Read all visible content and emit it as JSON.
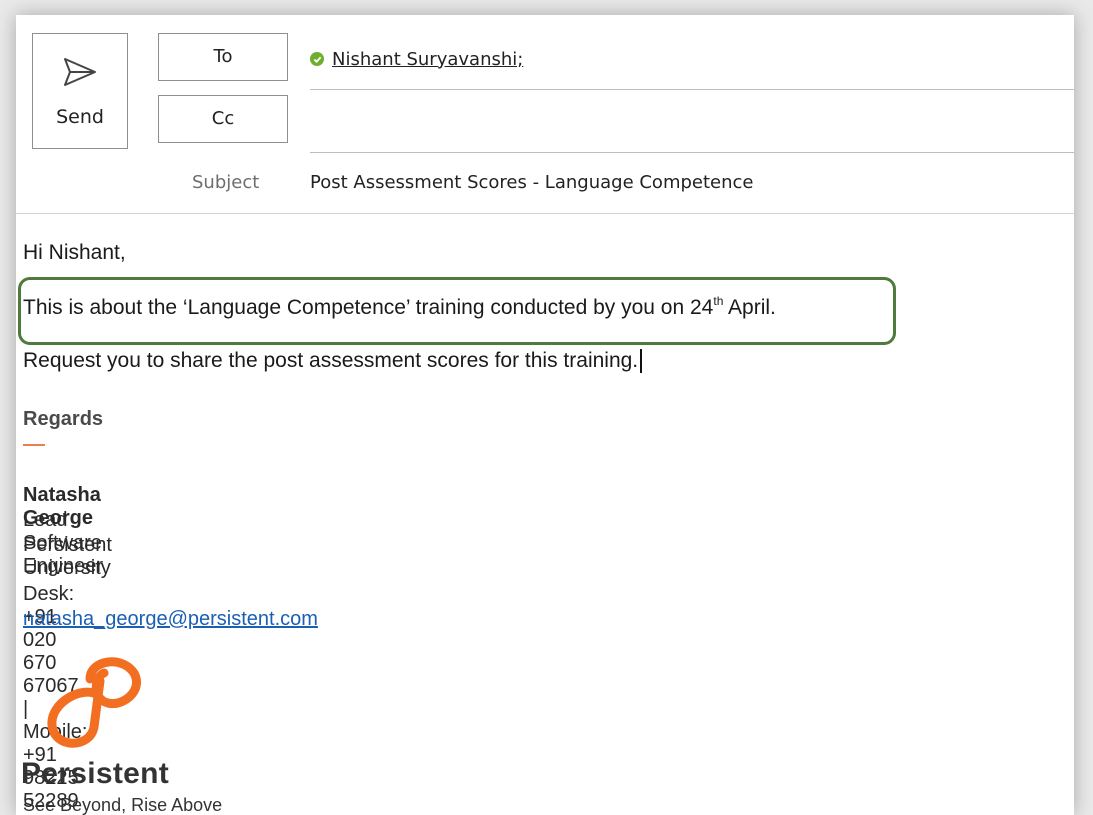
{
  "compose": {
    "send_label": "Send",
    "to_label": "To",
    "cc_label": "Cc",
    "subject_label": "Subject",
    "to_recipient": "Nishant Suryavanshi;",
    "cc_value": "",
    "subject_value": "Post Assessment Scores - Language Competence"
  },
  "body": {
    "greeting": "Hi Nishant,",
    "line1_before": "This is about the ‘Language Competence’ training conducted by you on 24",
    "line1_sup": "th",
    "line1_after": " April.",
    "line2": "Request you to share the post assessment scores for this training."
  },
  "signature": {
    "regards": "Regards",
    "name": "Natasha George",
    "title": "Lead Software Engineer",
    "org": "Persistent University",
    "phone": "Desk: +91 020 670 67067 | Mobile: +91 98225 52289",
    "email": "natasha_george@persistent.com"
  },
  "logo": {
    "word": "Persistent",
    "tagline": "See Beyond, Rise Above"
  },
  "colors": {
    "highlight_border": "#4e7a3c",
    "logo_orange": "#f26f21",
    "link": "#1a5fb4",
    "check_green": "#6fae2f"
  },
  "icons": [
    "send-icon",
    "check-icon"
  ]
}
